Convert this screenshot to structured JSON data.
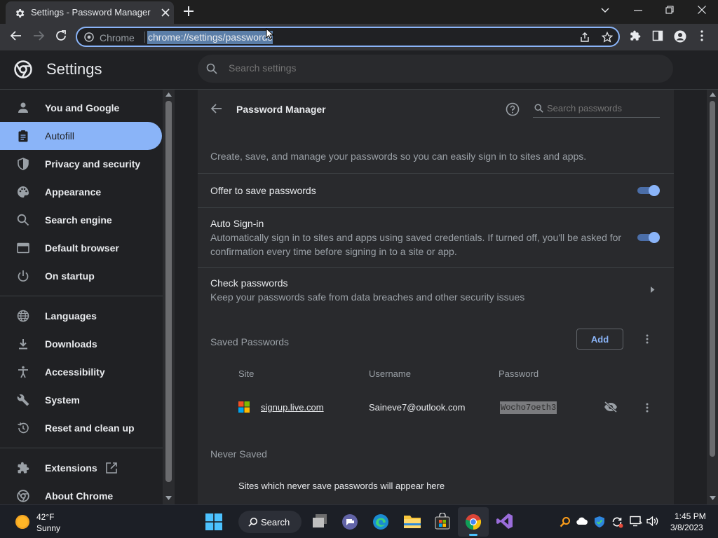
{
  "tab": {
    "title": "Settings - Password Manager"
  },
  "omnibox": {
    "chrome_label": "Chrome",
    "url": "chrome://settings/passwords"
  },
  "header": {
    "title": "Settings",
    "search_placeholder": "Search settings"
  },
  "sidebar": {
    "items": [
      {
        "label": "You and Google",
        "icon": "person-icon"
      },
      {
        "label": "Autofill",
        "icon": "clipboard-icon",
        "active": true
      },
      {
        "label": "Privacy and security",
        "icon": "shield-icon"
      },
      {
        "label": "Appearance",
        "icon": "palette-icon"
      },
      {
        "label": "Search engine",
        "icon": "search-icon"
      },
      {
        "label": "Default browser",
        "icon": "browser-icon"
      },
      {
        "label": "On startup",
        "icon": "power-icon"
      },
      {
        "label": "Languages",
        "icon": "globe-icon"
      },
      {
        "label": "Downloads",
        "icon": "download-icon"
      },
      {
        "label": "Accessibility",
        "icon": "accessibility-icon"
      },
      {
        "label": "System",
        "icon": "wrench-icon"
      },
      {
        "label": "Reset and clean up",
        "icon": "history-icon"
      },
      {
        "label": "Extensions",
        "icon": "puzzle-icon"
      },
      {
        "label": "About Chrome",
        "icon": "chrome-icon"
      }
    ]
  },
  "password_manager": {
    "title": "Password Manager",
    "search_placeholder": "Search passwords",
    "description": "Create, save, and manage your passwords so you can easily sign in to sites and apps.",
    "offer_to_save": {
      "label": "Offer to save passwords",
      "enabled": true
    },
    "auto_signin": {
      "label": "Auto Sign-in",
      "description_line1": "Automatically sign in to sites and apps using saved credentials. If turned off, you'll be asked for",
      "description_line2": "confirmation every time before signing in to a site or app.",
      "enabled": true
    },
    "check_passwords": {
      "label": "Check passwords",
      "description": "Keep your passwords safe from data breaches and other security issues"
    },
    "saved_passwords": {
      "heading": "Saved Passwords",
      "add_label": "Add",
      "columns": {
        "site": "Site",
        "username": "Username",
        "password": "Password"
      },
      "rows": [
        {
          "site": "signup.live.com",
          "username": "Saineve7@outlook.com",
          "password": "Wocho7oeth3"
        }
      ]
    },
    "never_saved": {
      "heading": "Never Saved",
      "empty_text": "Sites which never save passwords will appear here"
    }
  },
  "taskbar": {
    "weather_temp": "42°F",
    "weather_condition": "Sunny",
    "search_label": "Search",
    "time": "1:45 PM",
    "date": "3/8/2023"
  },
  "colors": {
    "accent": "#8ab4f8",
    "background": "#202124",
    "card": "#292a2d"
  }
}
